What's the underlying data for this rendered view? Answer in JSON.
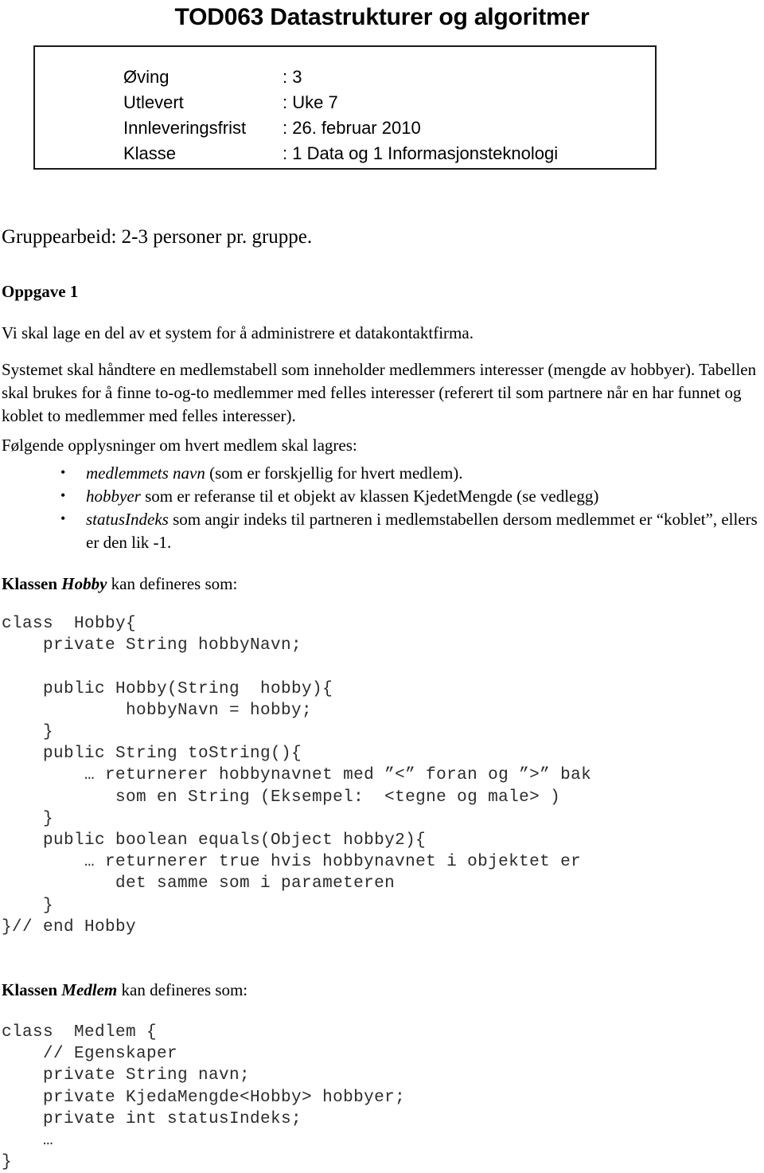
{
  "document": {
    "title": "TOD063 Datastrukturer og algoritmer"
  },
  "info_box": {
    "rows": [
      {
        "label": "Øving",
        "value": ": 3"
      },
      {
        "label": "Utlevert",
        "value": ": Uke 7"
      },
      {
        "label": "Innleveringsfrist",
        "value": ": 26. februar 2010"
      },
      {
        "label": "Klasse",
        "value": ": 1 Data og 1 Informasjonsteknologi"
      }
    ]
  },
  "body": {
    "group_note": "Gruppearbeid: 2-3 personer pr. gruppe.",
    "task_heading": "Oppgave 1",
    "paragraph_1": "Vi skal lage en del av et system for å administrere et datakontaktfirma.",
    "paragraph_2_a": "Systemet skal håndtere en medlemstabell som inneholder medlemmers interesser (mengde av hobbyer). Tabellen skal brukes for å finne to-og-to medlemmer med felles interesser (referert til som partnere når en har funnet og koblet to medlemmer med felles interesser).",
    "paragraph_3": "Følgende opplysninger om hvert medlem skal lagres:",
    "bullets": [
      {
        "term": "medlemmets navn",
        "rest": " (som er forskjellig for hvert medlem)."
      },
      {
        "term": "hobbyer",
        "rest": " som er referanse til et objekt av klassen KjedetMengde (se vedlegg)"
      },
      {
        "term": "statusIndeks",
        "rest": " som angir indeks til partneren i medlemstabellen dersom medlemmet er “koblet”, ellers er den lik -1."
      }
    ],
    "hobby_intro_prefix": "Klassen ",
    "hobby_intro_name": "Hobby",
    "hobby_intro_suffix": " kan defineres som:",
    "medlem_intro_prefix": "Klassen ",
    "medlem_intro_name": "Medlem",
    "medlem_intro_suffix": " kan defineres som:"
  },
  "code": {
    "hobby": "class  Hobby{\n    private String hobbyNavn;\n\n    public Hobby(String  hobby){\n            hobbyNavn = hobby;\n    }\n    public String toString(){\n        … returnerer hobbynavnet med ”<” foran og ”>” bak\n           som en String (Eksempel:  <tegne og male> )\n    }\n    public boolean equals(Object hobby2){\n        … returnerer true hvis hobbynavnet i objektet er\n           det samme som i parameteren\n    }\n}// end Hobby",
    "medlem": "class  Medlem {\n    // Egenskaper\n    private String navn;\n    private KjedaMengde<Hobby> hobbyer;\n    private int statusIndeks;\n    …\n}"
  },
  "colors": {
    "text": "#000000",
    "code_text": "#2b2b2b",
    "border": "#1a1a1a",
    "page_background": "#ffffff"
  }
}
